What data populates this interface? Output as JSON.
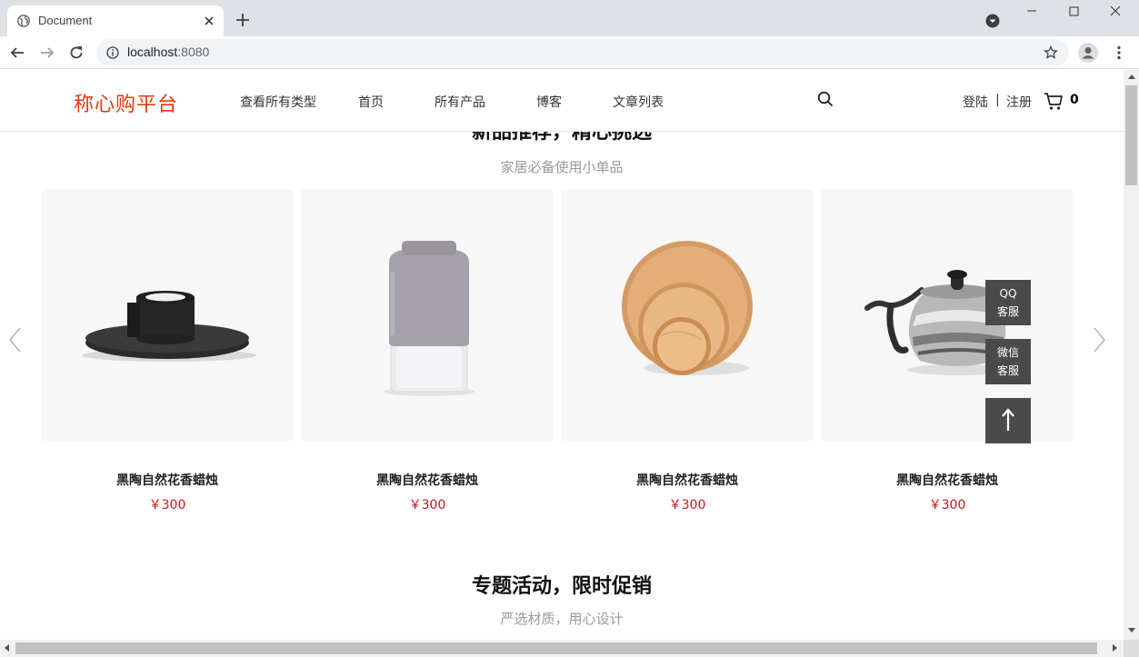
{
  "browser": {
    "tab_title": "Document",
    "url_host": "localhost",
    "url_port": ":8080"
  },
  "site": {
    "logo": "称心购平台",
    "nav": [
      "查看所有类型",
      "首页",
      "所有产品",
      "博客",
      "文章列表"
    ],
    "login": "登陆",
    "separator": "|",
    "register": "注册",
    "cart_count": "0"
  },
  "section1": {
    "title": "新品推荐，精心挑选",
    "subtitle": "家居必备使用小单品",
    "products": [
      {
        "name": "黑陶自然花香蜡烛",
        "price": "￥300",
        "image": "black-ceramic-candle-holder"
      },
      {
        "name": "黑陶自然花香蜡烛",
        "price": "￥300",
        "image": "grey-velvet-vase"
      },
      {
        "name": "黑陶自然花香蜡烛",
        "price": "￥300",
        "image": "wooden-plates-stack"
      },
      {
        "name": "黑陶自然花香蜡烛",
        "price": "￥300",
        "image": "steel-kettle"
      }
    ]
  },
  "floating": {
    "qq_line1": "QQ",
    "qq_line2": "客服",
    "wechat_line1": "微信",
    "wechat_line2": "客服"
  },
  "section2": {
    "title": "专题活动，限时促销",
    "subtitle": "严选材质，用心设计"
  },
  "colors": {
    "logo": "#e8380d",
    "price": "#c8161d",
    "float_bg": "#4a4a4a"
  }
}
